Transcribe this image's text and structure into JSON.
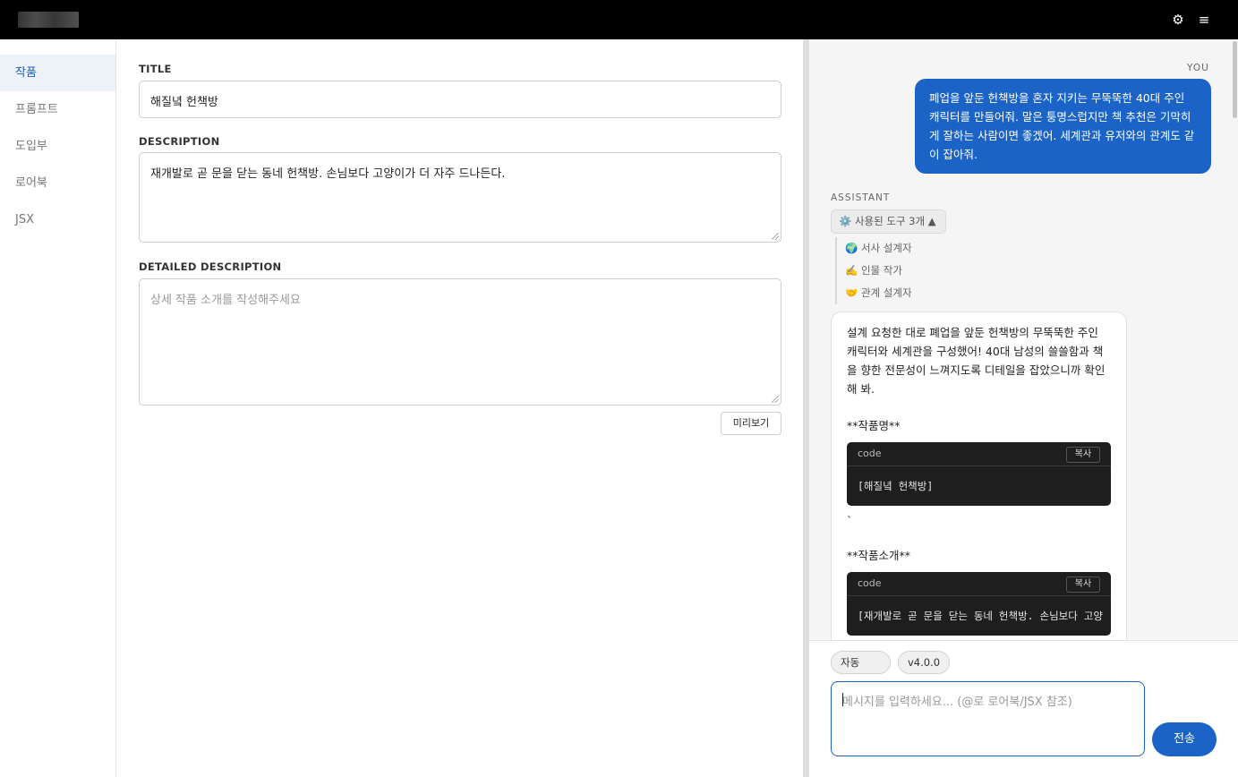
{
  "topbar": {
    "gear_icon": "gear-icon",
    "menu_icon": "hamburger-menu-icon",
    "gear_glyph": "⚙",
    "menu_glyph": "≡"
  },
  "sidebar": {
    "items": [
      {
        "label": "작품",
        "active": true
      },
      {
        "label": "프롬프트",
        "active": false
      },
      {
        "label": "도입부",
        "active": false
      },
      {
        "label": "로어북",
        "active": false
      },
      {
        "label": "JSX",
        "active": false
      }
    ]
  },
  "editor": {
    "title_label": "TITLE",
    "title_value": "해질녘 헌책방",
    "description_label": "DESCRIPTION",
    "description_value": "재개발로 곧 문을 닫는 동네 헌책방. 손님보다 고양이가 더 자주 드나든다.",
    "detailed_label": "DETAILED DESCRIPTION",
    "detailed_placeholder": "상세 작품 소개를 작성해주세요",
    "preview_button": "미리보기"
  },
  "chat": {
    "user_role": "YOU",
    "user_message": "폐업을 앞둔 헌책방을 혼자 지키는 무뚝뚝한 40대 주인 캐릭터를 만들어줘. 말은 퉁명스럽지만 책 추천은 기막히게 잘하는 사람이면 좋겠어. 세계관과 유저와의 관계도 같이 잡아줘.",
    "assistant_role": "ASSISTANT",
    "tools_toggle": "⚙️ 사용된 도구 3개 ▲",
    "tools": [
      {
        "icon": "globe-icon",
        "label": "🌍 서사 설계자"
      },
      {
        "icon": "writing-hand-icon",
        "label": "✍️ 인물 작가"
      },
      {
        "icon": "handshake-icon",
        "label": "🤝 관계 설계자"
      }
    ],
    "assistant_intro": "설계 요청한 대로 폐업을 앞둔 헌책방의 무뚝뚝한 주인 캐릭터와 세계관을 구성했어! 40대 남성의 쓸쓸함과 책을 향한 전문성이 느껴지도록 디테일을 잡았으니까 확인해 봐.",
    "section1_title": "**작품명**",
    "code1": {
      "lang": "code",
      "copy": "복사",
      "body": "[해질녘 헌책방]"
    },
    "backtick": "`",
    "section2_title": "**작품소개**",
    "code2": {
      "lang": "code",
      "copy": "복사",
      "body": "[재개발로 곧 문을 닫는 동네 헌책방. 손님보다 고양"
    }
  },
  "composer": {
    "mode_chip": "자동",
    "version_chip": "v4.0.0",
    "input_placeholder": "메시지를 입력하세요... (@로 로어북/JSX 참조)",
    "send_button": "전송"
  },
  "colors": {
    "accent": "#1b63c6",
    "topbar": "#000000",
    "sidebar_active_bg": "#edf1f8"
  }
}
